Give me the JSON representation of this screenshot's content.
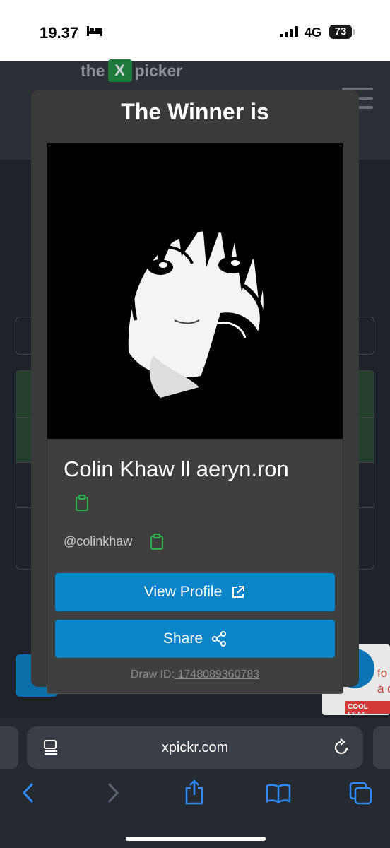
{
  "status_bar": {
    "time": "19.37",
    "network": "4G",
    "battery": "73"
  },
  "background": {
    "logo_prefix": "the",
    "logo_x": "X",
    "logo_suffix": "picker",
    "ad_text": "fo\na do",
    "ad_banner": "COOL FEAT"
  },
  "modal": {
    "title": "The Winner is",
    "winner_name": "Colin Khaw ll aeryn.ron",
    "handle": "@colinkhaw",
    "view_profile_label": "View Profile",
    "share_label": "Share",
    "draw_id_label": "Draw ID:",
    "draw_id_value": " 1748089360783"
  },
  "browser": {
    "url": "xpickr.com"
  },
  "colors": {
    "accent_button": "#0a85c9",
    "copy_icon": "#2fb24c",
    "modal_bg": "#3a3a3a"
  }
}
